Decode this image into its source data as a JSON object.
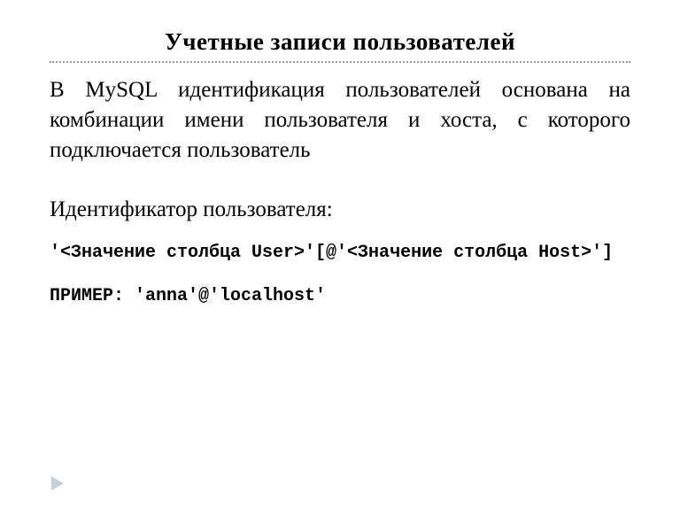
{
  "title": "Учетные записи пользователей",
  "body": "В MySQL идентификация пользователей основана на комбинации имени пользователя и хоста, с которого подключается пользователь",
  "subhead": "Идентификатор пользователя:",
  "syntax": "'<Значение столбца User>'[@'<Значение столбца Host>']",
  "example": "ПРИМЕР: 'anna'@'localhost'"
}
